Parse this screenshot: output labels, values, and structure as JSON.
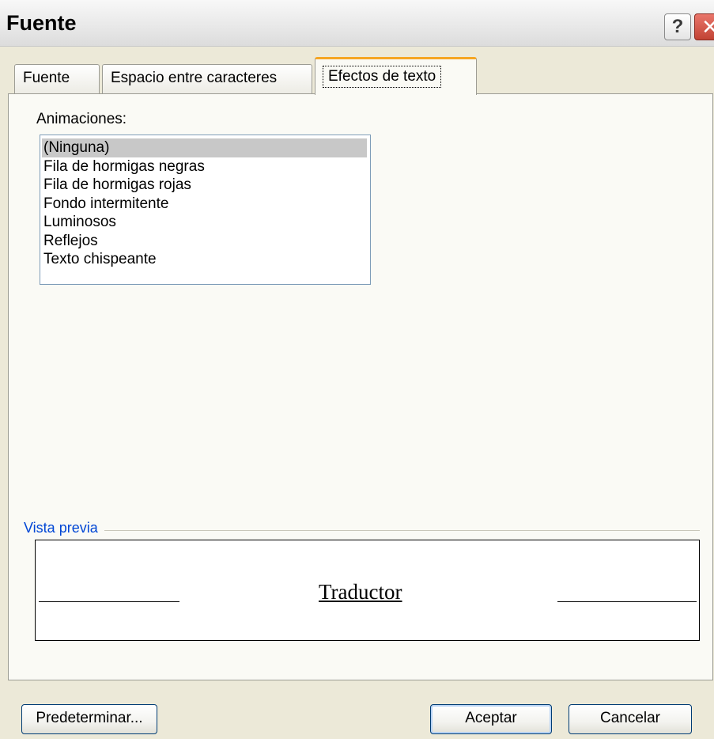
{
  "window": {
    "title": "Fuente",
    "help_icon": "?",
    "close_icon": "✕"
  },
  "tabs": [
    {
      "label": "Fuente",
      "active": false
    },
    {
      "label": "Espacio entre caracteres",
      "active": false
    },
    {
      "label": "Efectos de texto",
      "active": true
    }
  ],
  "animaciones": {
    "label": "Animaciones:",
    "selected": "(Ninguna)",
    "items": [
      "(Ninguna)",
      "Fila de hormigas negras",
      "Fila de hormigas rojas",
      "Fondo intermitente",
      "Luminosos",
      "Reflejos",
      "Texto chispeante"
    ]
  },
  "preview": {
    "group_label": "Vista previa",
    "sample_text": "Traductor"
  },
  "buttons": {
    "default": "Predeterminar...",
    "ok": "Aceptar",
    "cancel": "Cancelar"
  },
  "colors": {
    "dialog_bg": "#ece9d8",
    "active_tab_accent": "#f5a623",
    "group_label": "#0046d5",
    "close_button": "#c24334"
  }
}
